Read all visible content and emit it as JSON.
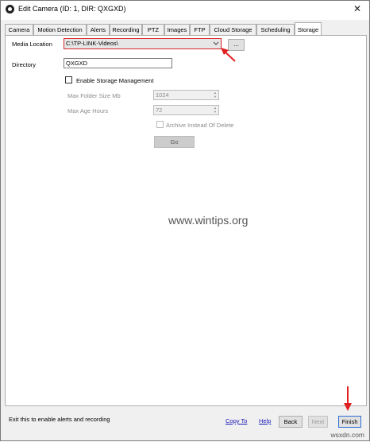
{
  "window": {
    "title": "Edit Camera (ID: 1, DIR: QXGXD)",
    "close_glyph": "✕"
  },
  "tabs": [
    {
      "label": "Camera"
    },
    {
      "label": "Motion Detection"
    },
    {
      "label": "Alerts"
    },
    {
      "label": "Recording"
    },
    {
      "label": "PTZ"
    },
    {
      "label": "Images"
    },
    {
      "label": "FTP"
    },
    {
      "label": "Cloud Storage"
    },
    {
      "label": "Scheduling"
    },
    {
      "label": "Storage",
      "active": true
    }
  ],
  "storage": {
    "media_location_label": "Media Location",
    "media_location_value": "C:\\TP-LINK-Videos\\",
    "browse_label": "...",
    "directory_label": "Directory",
    "directory_value": "QXGXD",
    "enable_storage_label": "Enable Storage Management",
    "enable_storage_checked": false,
    "max_folder_label": "Max Folder Size Mb",
    "max_folder_value": "1024",
    "max_age_label": "Max Age Hours",
    "max_age_value": "72",
    "archive_label": "Archive Instead Of Delete",
    "archive_checked": false,
    "go_label": "Go"
  },
  "watermark": "www.wintips.org",
  "footer": {
    "status_text": "Exit this to enable alerts and recording",
    "copy_to": "Copy To",
    "help": "Help",
    "back": "Back",
    "next": "Next",
    "finish": "Finish"
  },
  "site_watermark": "wsxdn.com",
  "colors": {
    "highlight_red": "#d9262a",
    "link_blue": "#1a1ab8",
    "focus_blue": "#2b6fd4"
  }
}
